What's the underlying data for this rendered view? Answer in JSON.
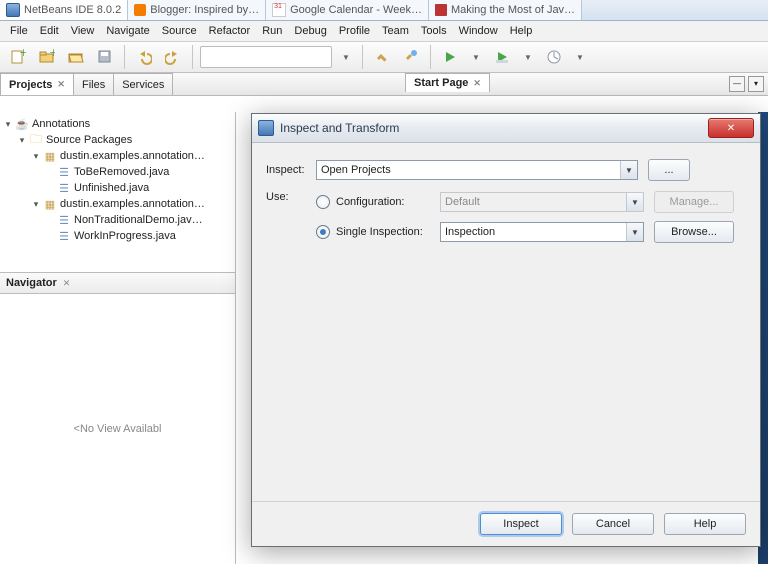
{
  "browserTabs": {
    "t1": "NetBeans IDE 8.0.2",
    "t2": "Blogger: Inspired by…",
    "t3": "Google Calendar - Week…",
    "t4": "Making the Most of Jav…"
  },
  "appTitle": "NetBeans IDE 8.0.2",
  "menu": [
    "File",
    "Edit",
    "View",
    "Navigate",
    "Source",
    "Refactor",
    "Run",
    "Debug",
    "Profile",
    "Team",
    "Tools",
    "Window",
    "Help"
  ],
  "projectTabs": {
    "projects": "Projects",
    "files": "Files",
    "services": "Services"
  },
  "editorTabs": {
    "start": "Start Page"
  },
  "tree": {
    "root": "Annotations",
    "srcpkg": "Source Packages",
    "pkg1": "dustin.examples.annotation…",
    "f1": "ToBeRemoved.java",
    "f2": "Unfinished.java",
    "pkg2": "dustin.examples.annotation…",
    "f3": "NonTraditionalDemo.jav…",
    "f4": "WorkInProgress.java"
  },
  "navigator": {
    "title": "Navigator",
    "empty": "<No View Availabl"
  },
  "dialog": {
    "title": "Inspect and Transform",
    "inspectLabel": "Inspect:",
    "inspectValue": "Open Projects",
    "dots": "...",
    "useLabel": "Use:",
    "configLabel": "Configuration:",
    "configValue": "Default",
    "manage": "Manage...",
    "singleLabel": "Single Inspection:",
    "singleValue": "Inspection",
    "browse": "Browse...",
    "inspectBtn": "Inspect",
    "cancelBtn": "Cancel",
    "helpBtn": "Help"
  }
}
